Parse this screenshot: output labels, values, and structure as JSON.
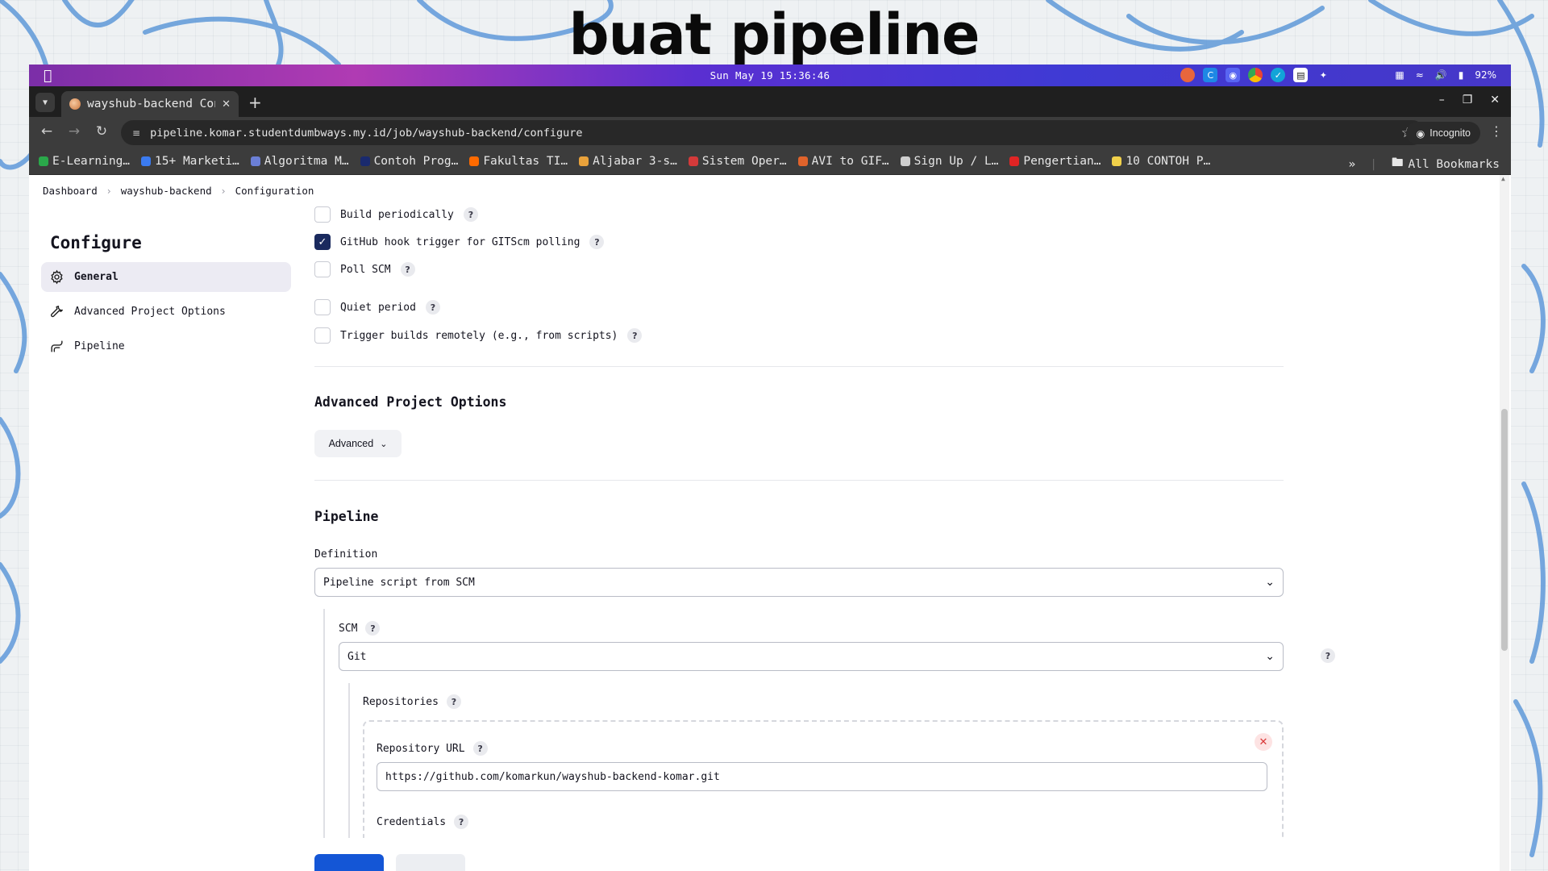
{
  "slide": {
    "title": "buat pipeline"
  },
  "menubar": {
    "clock": "Sun May 19 15:36:46",
    "battery": "92%"
  },
  "browser": {
    "tab_title": "wayshub-backend Con",
    "url": "pipeline.komar.studentdumbways.my.id/job/wayshub-backend/configure",
    "incognito_label": "Incognito",
    "bookmarks": [
      {
        "label": "E-Learning…",
        "icon_color": "#2aa84a"
      },
      {
        "label": "15+ Marketi…",
        "icon_color": "#3b7bf0"
      },
      {
        "label": "Algoritma M…",
        "icon_color": "#6b7fd6"
      },
      {
        "label": "Contoh Prog…",
        "icon_color": "#1a2a6e"
      },
      {
        "label": "Fakultas TI…",
        "icon_color": "#ff6a00"
      },
      {
        "label": "Aljabar 3-s…",
        "icon_color": "#e9a23b"
      },
      {
        "label": "Sistem Oper…",
        "icon_color": "#d33a3a"
      },
      {
        "label": "AVI to GIF…",
        "icon_color": "#e0632b"
      },
      {
        "label": "Sign Up / L…",
        "icon_color": "#cfcfcf"
      },
      {
        "label": "Pengertian…",
        "icon_color": "#e02424"
      },
      {
        "label": "10 CONTOH P…",
        "icon_color": "#f0d04a"
      }
    ],
    "all_bookmarks_label": "All Bookmarks"
  },
  "breadcrumbs": {
    "item1": "Dashboard",
    "item2": "wayshub-backend",
    "item3": "Configuration"
  },
  "sidebar": {
    "title": "Configure",
    "items": [
      {
        "label": "General",
        "icon": "gear-icon"
      },
      {
        "label": "Advanced Project Options",
        "icon": "wrench-icon"
      },
      {
        "label": "Pipeline",
        "icon": "pipeline-icon"
      }
    ]
  },
  "triggers": [
    {
      "label": "Build periodically",
      "checked": false
    },
    {
      "label": "GitHub hook trigger for GITScm polling",
      "checked": true
    },
    {
      "label": "Poll SCM",
      "checked": false
    },
    {
      "label": "Quiet period",
      "checked": false
    },
    {
      "label": "Trigger builds remotely (e.g., from scripts)",
      "checked": false
    }
  ],
  "advanced_section": {
    "title": "Advanced Project Options",
    "button_label": "Advanced"
  },
  "pipeline_section": {
    "title": "Pipeline",
    "definition_label": "Definition",
    "definition_value": "Pipeline script from SCM",
    "scm_label": "SCM",
    "scm_value": "Git",
    "repositories_label": "Repositories",
    "repo_url_label": "Repository URL",
    "repo_url_value": "https://github.com/komarkun/wayshub-backend-komar.git",
    "credentials_label": "Credentials"
  },
  "colors": {
    "checked_box": "#1a2a5e",
    "save_button": "#1456d6",
    "delete_x": "#d93838"
  }
}
